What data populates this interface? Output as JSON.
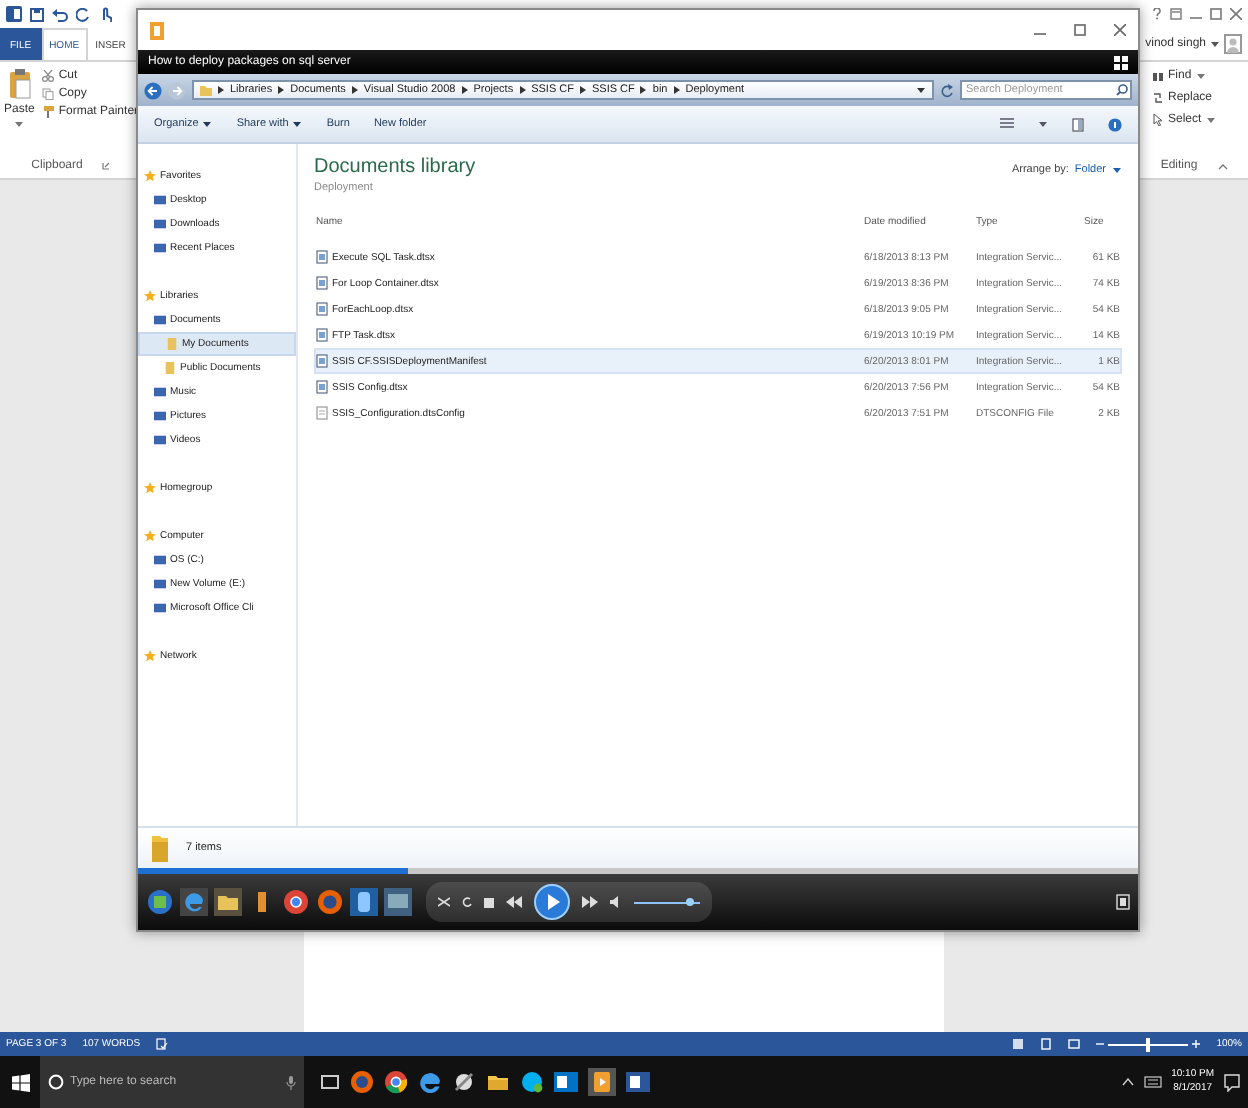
{
  "word": {
    "tabs": [
      {
        "label": "FILE",
        "selected": false,
        "kind": "file"
      },
      {
        "label": "HOME",
        "selected": true,
        "kind": "tab"
      },
      {
        "label": "INSER",
        "selected": false,
        "kind": "tab"
      }
    ],
    "clipboard": {
      "paste": "Paste",
      "cut": "Cut",
      "copy": "Copy",
      "format_painter": "Format Painter",
      "group_label": "Clipboard"
    },
    "user": "vinod singh",
    "editing": {
      "find": "Find",
      "replace": "Replace",
      "select": "Select",
      "group_label": "Editing"
    },
    "status_bar": {
      "page": "PAGE 3 OF 3",
      "words": "107 WORDS",
      "zoom": "100%"
    }
  },
  "explorer": {
    "title": "How to deploy packages on sql server",
    "breadcrumb": [
      "Libraries",
      "Documents",
      "Visual Studio 2008",
      "Projects",
      "SSIS CF",
      "SSIS CF",
      "bin",
      "Deployment"
    ],
    "search": {
      "placeholder": "Search Deployment"
    },
    "toolbar": [
      {
        "label": "Organize",
        "kind": "menu"
      },
      {
        "label": "Share with",
        "kind": "menu"
      },
      {
        "label": "Burn",
        "kind": "button"
      },
      {
        "label": "New folder",
        "kind": "button"
      }
    ],
    "nav": [
      {
        "label": "Favorites",
        "selected": false,
        "children": [
          {
            "label": "Desktop",
            "selected": false
          },
          {
            "label": "Downloads",
            "selected": false
          },
          {
            "label": "Recent Places",
            "selected": false
          }
        ]
      },
      {
        "label": "Libraries",
        "selected": false,
        "children": [
          {
            "label": "Documents",
            "selected": false,
            "children": [
              {
                "label": "My Documents",
                "selected": true
              },
              {
                "label": "Public Documents",
                "selected": false
              }
            ]
          },
          {
            "label": "Music",
            "selected": false
          },
          {
            "label": "Pictures",
            "selected": false
          },
          {
            "label": "Videos",
            "selected": false
          }
        ]
      },
      {
        "label": "Homegroup",
        "selected": false
      },
      {
        "label": "Computer",
        "selected": false,
        "children": [
          {
            "label": "OS (C:)",
            "selected": false
          },
          {
            "label": "New Volume (E:)",
            "selected": false
          },
          {
            "label": "Microsoft Office Cli",
            "selected": false
          }
        ]
      },
      {
        "label": "Network",
        "selected": false
      }
    ],
    "library_title": "Documents library",
    "library_subtitle": "Deployment",
    "arrange_label": "Arrange by:",
    "arrange_value": "Folder",
    "columns": [
      "Name",
      "Date modified",
      "Type",
      "Size"
    ],
    "rows": [
      {
        "name": "Execute SQL Task.dtsx",
        "date": "6/18/2013 8:13 PM",
        "type": "Integration Servic...",
        "size": "61 KB",
        "selected": false,
        "kind": "package"
      },
      {
        "name": "For Loop Container.dtsx",
        "date": "6/19/2013 8:36 PM",
        "type": "Integration Servic...",
        "size": "74 KB",
        "selected": false,
        "kind": "package"
      },
      {
        "name": "ForEachLoop.dtsx",
        "date": "6/18/2013 9:05 PM",
        "type": "Integration Servic...",
        "size": "54 KB",
        "selected": false,
        "kind": "package"
      },
      {
        "name": "FTP Task.dtsx",
        "date": "6/19/2013 10:19 PM",
        "type": "Integration Servic...",
        "size": "14 KB",
        "selected": false,
        "kind": "package"
      },
      {
        "name": "SSIS CF.SSISDeploymentManifest",
        "date": "6/20/2013 8:01 PM",
        "type": "Integration Servic...",
        "size": "1 KB",
        "selected": true,
        "kind": "package"
      },
      {
        "name": "SSIS Config.dtsx",
        "date": "6/20/2013 7:56 PM",
        "type": "Integration Servic...",
        "size": "54 KB",
        "selected": false,
        "kind": "package"
      },
      {
        "name": "SSIS_Configuration.dtsConfig",
        "date": "6/20/2013 7:51 PM",
        "type": "DTSCONFIG File",
        "size": "2 KB",
        "selected": false,
        "kind": "config"
      }
    ],
    "item_count": "7 items"
  },
  "player": {
    "progress": {
      "level": 0.27
    }
  },
  "taskbar": {
    "search": {
      "placeholder": "Type here to search"
    },
    "time": "10:10 PM",
    "date": "8/1/2017"
  }
}
